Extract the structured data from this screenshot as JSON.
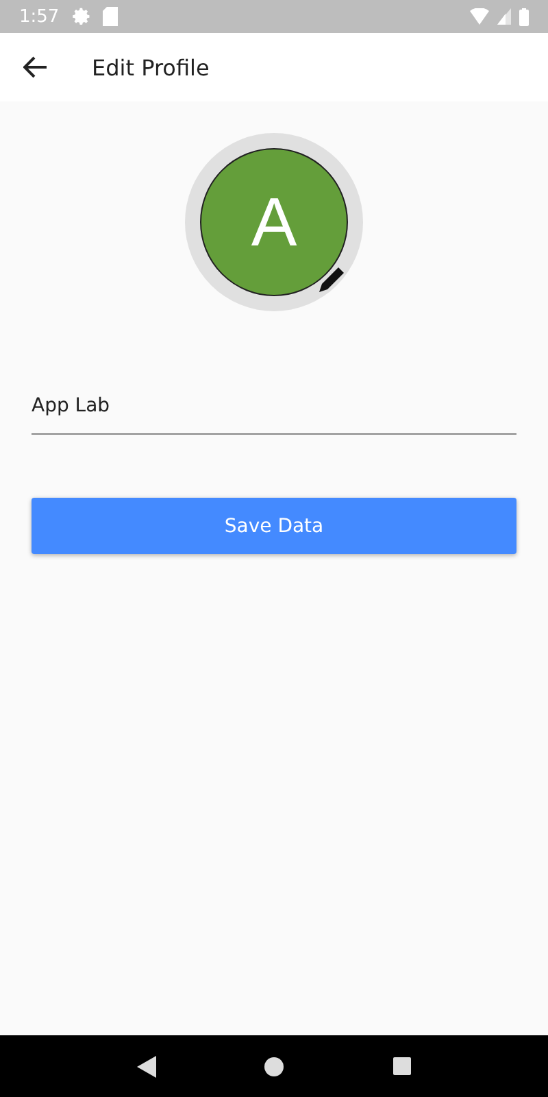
{
  "status_bar": {
    "time": "1:57"
  },
  "app_bar": {
    "title": "Edit Profile"
  },
  "avatar": {
    "initial": "A"
  },
  "name_field": {
    "value": "App Lab"
  },
  "save_button": {
    "label": "Save Data"
  }
}
